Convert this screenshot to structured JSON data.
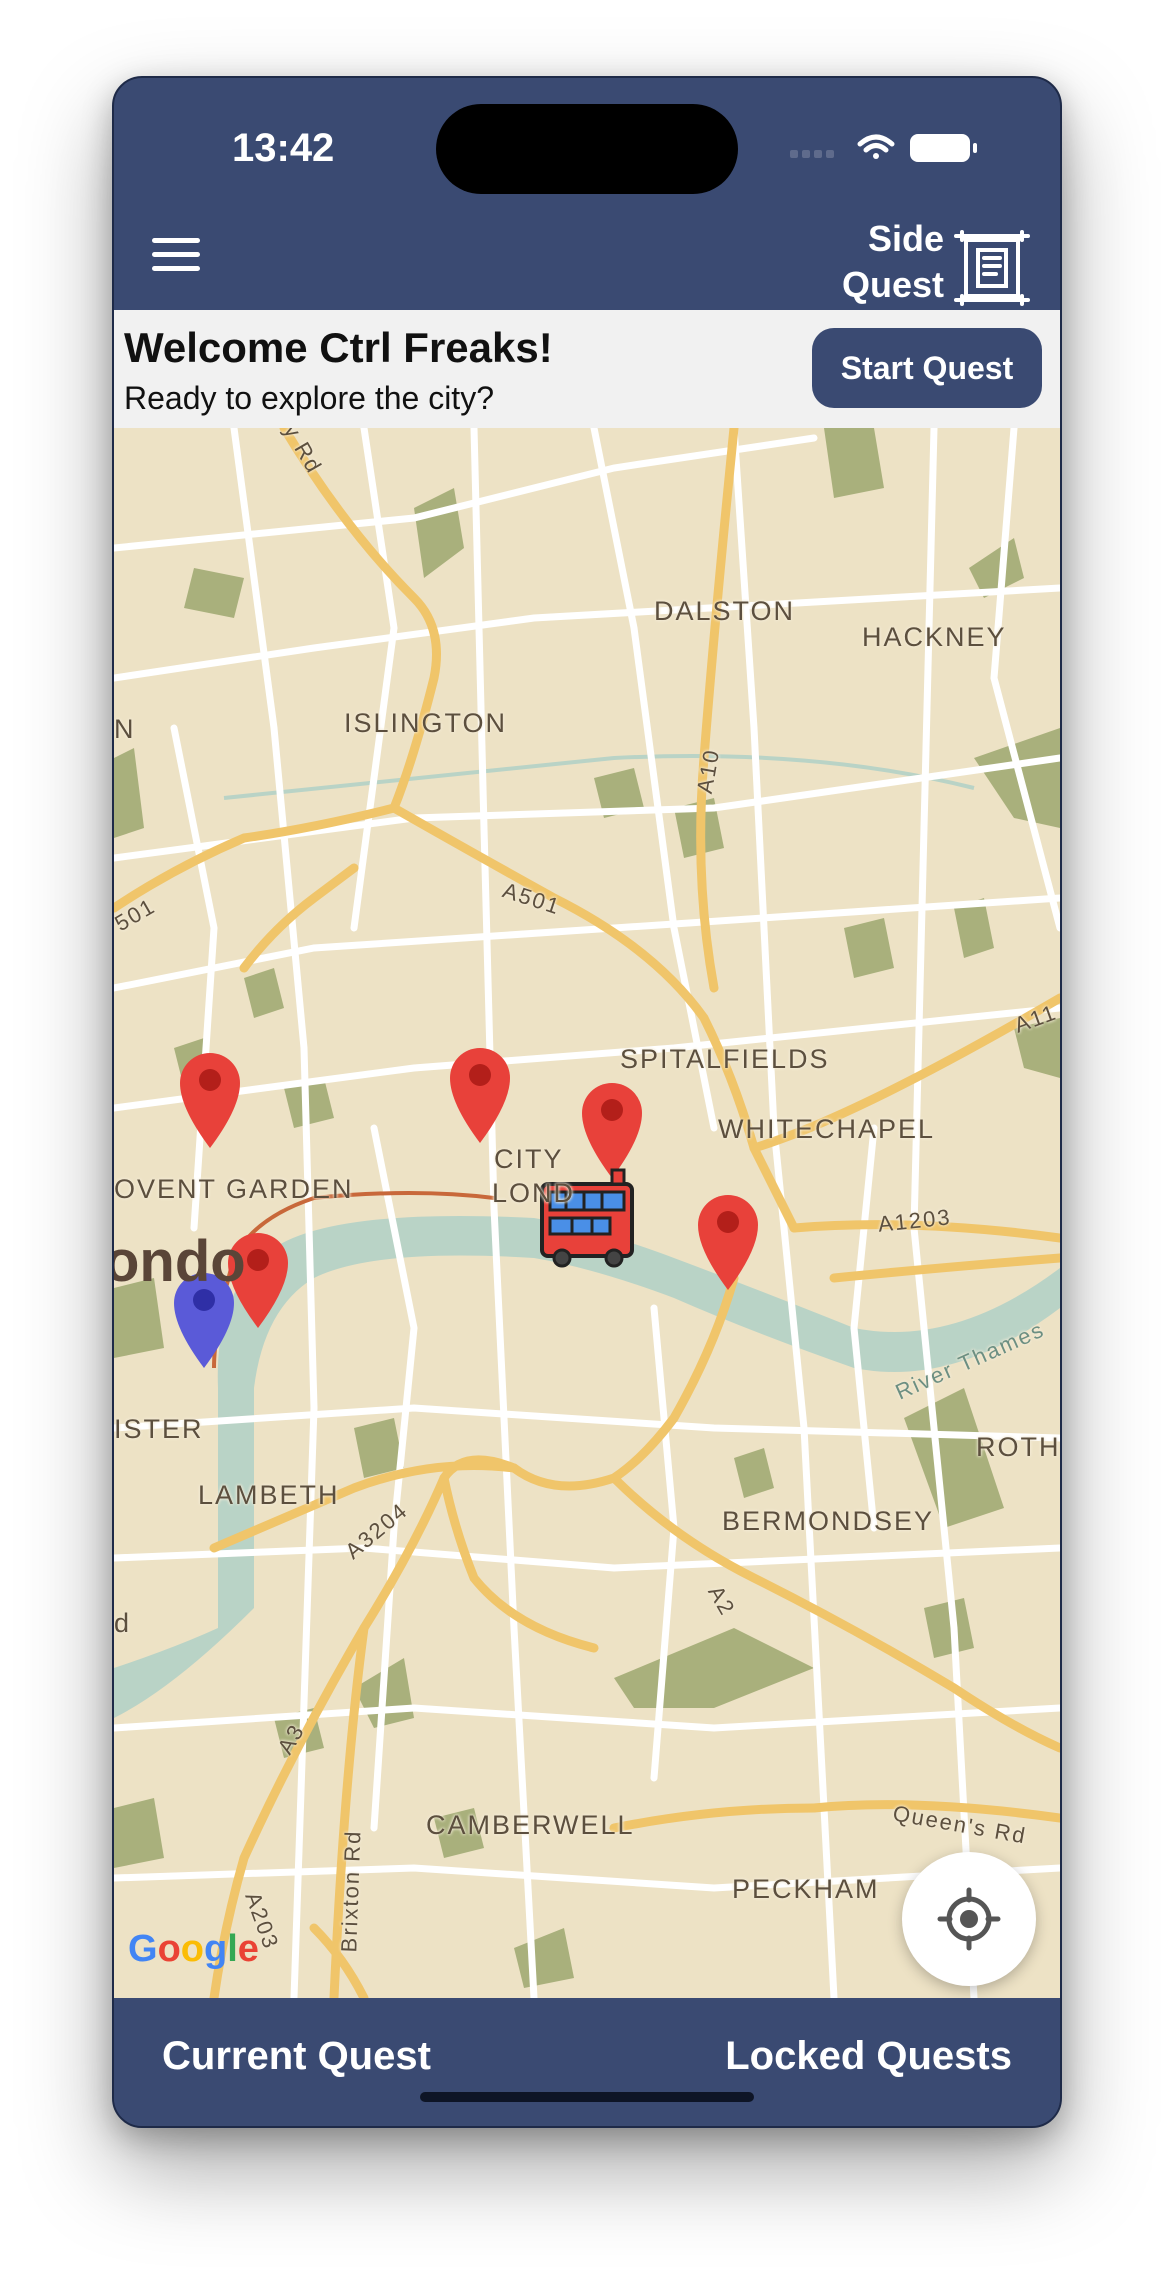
{
  "status_bar": {
    "time": "13:42"
  },
  "header": {
    "brand": [
      "Side",
      "Quest"
    ]
  },
  "welcome": {
    "title": "Welcome Ctrl Freaks!",
    "subtitle": "Ready to explore the city?",
    "start_button": "Start Quest"
  },
  "map": {
    "labels": {
      "dalston": "DALSTON",
      "hackney": "HACKNEY",
      "islington": "ISLINGTON",
      "spitalfields": "SPITALFIELDS",
      "whitechapel": "WHITECHAPEL",
      "city": "CITY",
      "lond": "LOND",
      "covent_garden": "OVENT GARDEN",
      "london": "ondo",
      "ister": "ISTER",
      "lambeth": "LAMBETH",
      "bermondsey": "BERMONDSEY",
      "roth": "ROTH",
      "camberwell": "CAMBERWELL",
      "peckham": "PECKHAM",
      "a501": "A501",
      "a10": "A10",
      "a11": "A11",
      "a1203": "A1203",
      "a3204": "A3204",
      "a2": "A2",
      "a3": "A3",
      "a203": "A203",
      "brixton_rd": "Brixton Rd",
      "queens_rd": "Queen's Rd",
      "river_thames": "River Thames",
      "y_rd": "y Rd",
      "n_edge": "N",
      "a501_left": "501",
      "d_edge": "d"
    },
    "attribution": "Google",
    "pins": [
      {
        "type": "quest",
        "color": "#e8413a",
        "label": "Covent Garden pin"
      },
      {
        "type": "quest",
        "color": "#e8413a",
        "label": "Holborn pin"
      },
      {
        "type": "quest",
        "color": "#e8413a",
        "label": "City of London pin"
      },
      {
        "type": "quest",
        "color": "#e8413a",
        "label": "Tower pin"
      },
      {
        "type": "quest",
        "color": "#e8413a",
        "label": "Westminster pin"
      },
      {
        "type": "user",
        "color": "#5a5ad8",
        "label": "Current location"
      }
    ]
  },
  "bottom_nav": {
    "current": "Current Quest",
    "locked": "Locked Quests"
  },
  "colors": {
    "primary": "#3a4a72",
    "map_bg": "#ede2c5",
    "park": "#a9b07c",
    "road_major": "#f0c56a",
    "river": "#b9d3c6",
    "pin_red": "#e8413a",
    "pin_blue": "#5a5ad8"
  }
}
